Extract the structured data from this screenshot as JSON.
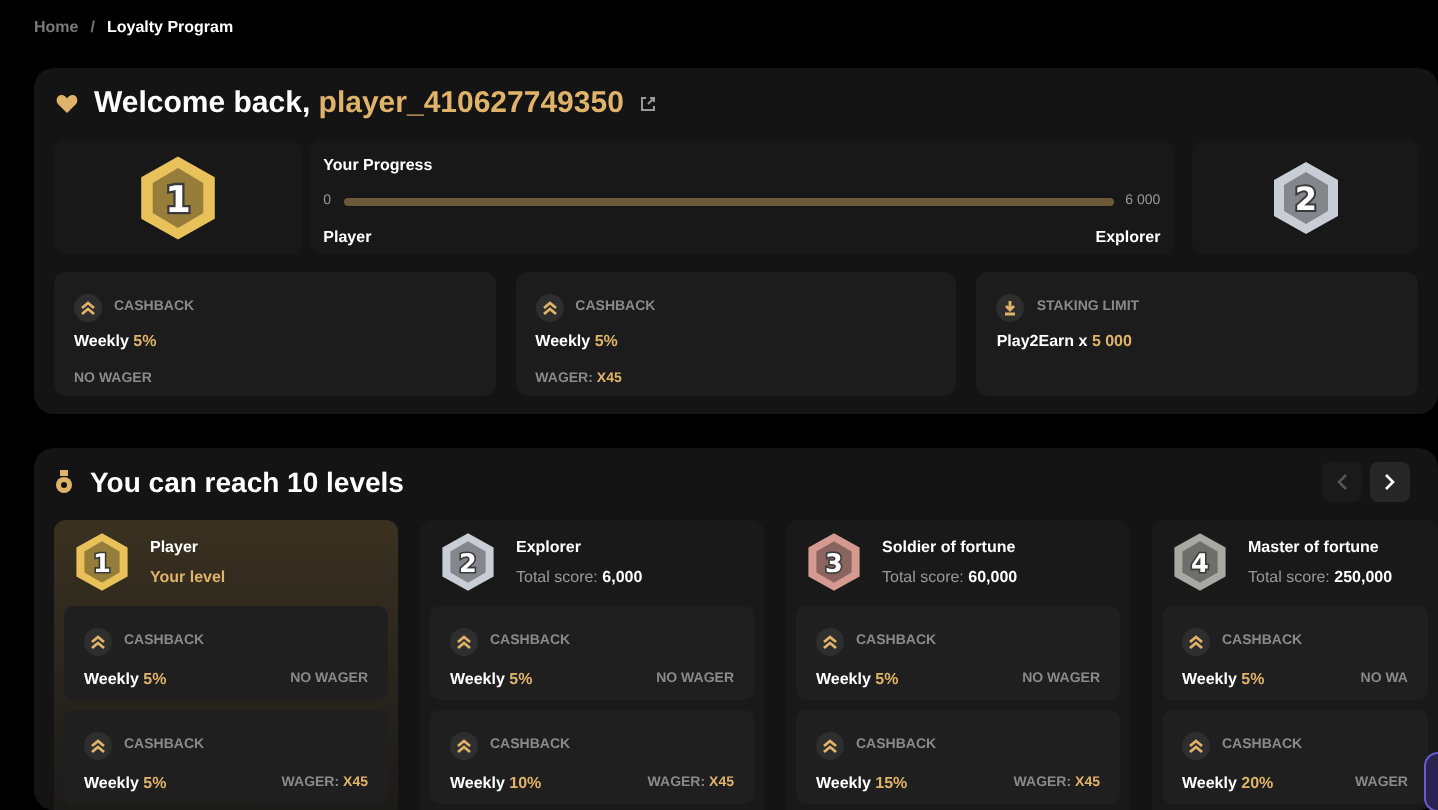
{
  "breadcrumb": {
    "separator": "/",
    "items": [
      {
        "label": "Home",
        "selected": false
      },
      {
        "label": "Loyalty Program",
        "selected": true
      }
    ]
  },
  "welcome": {
    "title": "Welcome back,",
    "username": "player_410627749350",
    "current_badge": {
      "number": "1",
      "color": "#e8c15a"
    },
    "progress": {
      "title": "Your Progress",
      "min": "0",
      "max": "6 000",
      "level": 0,
      "from": "Player",
      "to": "Explorer"
    },
    "next_badge": {
      "number": "2",
      "color": "#c9ced6"
    },
    "perks": [
      {
        "kind": "cashback",
        "label": "CASHBACK",
        "text": "Weekly",
        "value": "5%",
        "note": "NO WAGER"
      },
      {
        "kind": "cashback",
        "label": "CASHBACK",
        "text": "Weekly",
        "value": "5%",
        "note": "WAGER:",
        "note_value": "X45"
      },
      {
        "kind": "staking",
        "label": "STAKING LIMIT",
        "text": "Play2Earn x",
        "value": "5 000"
      }
    ]
  },
  "levels_section": {
    "title": "You can reach 10 levels",
    "prev_disabled": true,
    "levels": [
      {
        "name": "Player",
        "number": "1",
        "color": "#e8c15a",
        "current": true,
        "subtitle": "Your level",
        "benefits": [
          {
            "label": "CASHBACK",
            "text": "Weekly",
            "value": "5%",
            "note": "NO WAGER"
          },
          {
            "label": "CASHBACK",
            "text": "Weekly",
            "value": "5%",
            "note": "WAGER:",
            "note_value": "X45"
          }
        ]
      },
      {
        "name": "Explorer",
        "number": "2",
        "color": "#c9ced6",
        "current": false,
        "score_label": "Total score:",
        "score": "6,000",
        "benefits": [
          {
            "label": "CASHBACK",
            "text": "Weekly",
            "value": "5%",
            "note": "NO WAGER"
          },
          {
            "label": "CASHBACK",
            "text": "Weekly",
            "value": "10%",
            "note": "WAGER:",
            "note_value": "X45"
          }
        ]
      },
      {
        "name": "Soldier of fortune",
        "number": "3",
        "color": "#d49a92",
        "current": false,
        "score_label": "Total score:",
        "score": "60,000",
        "benefits": [
          {
            "label": "CASHBACK",
            "text": "Weekly",
            "value": "5%",
            "note": "NO WAGER"
          },
          {
            "label": "CASHBACK",
            "text": "Weekly",
            "value": "15%",
            "note": "WAGER:",
            "note_value": "X45"
          }
        ]
      },
      {
        "name": "Master of fortune",
        "number": "4",
        "color": "#a9a9a3",
        "current": false,
        "score_label": "Total score:",
        "score": "250,000",
        "benefits": [
          {
            "label": "CASHBACK",
            "text": "Weekly",
            "value": "5%",
            "note": "NO WA"
          },
          {
            "label": "CASHBACK",
            "text": "Weekly",
            "value": "20%",
            "note": "WAGER"
          }
        ]
      }
    ]
  }
}
